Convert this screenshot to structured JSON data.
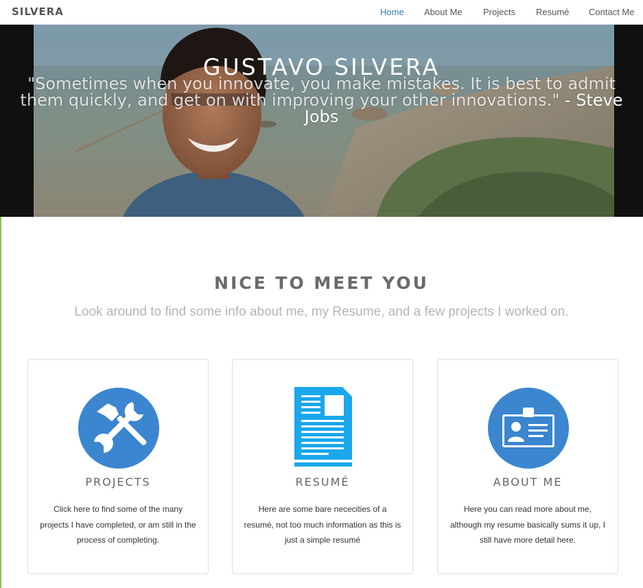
{
  "nav": {
    "brand": "SILVERA",
    "items": [
      {
        "label": "Home",
        "active": true
      },
      {
        "label": "About Me"
      },
      {
        "label": "Projects"
      },
      {
        "label": "Resumé"
      },
      {
        "label": "Contact Me"
      }
    ]
  },
  "hero": {
    "title": "GUSTAVO SILVERA",
    "quote": "\"Sometimes when you innovate, you make mistakes. It is best to admit them quickly, and get on with improving your other innovations.\"",
    "author": "- Steve Jobs"
  },
  "welcome": {
    "title": "NICE TO MEET YOU",
    "subtitle": "Look around to find some info about me, my Resume, and a few projects I worked on."
  },
  "cards": [
    {
      "icon": "tools-icon",
      "title": "PROJECTS",
      "text": "Click here to find some of the many projects I have completed, or am still in the process of completing."
    },
    {
      "icon": "document-icon",
      "title": "RESUMÉ",
      "text": "Here are some bare nececities of a resumé, not too much information as this is just a simple resumé"
    },
    {
      "icon": "id-badge-icon",
      "title": "ABOUT ME",
      "text": "Here you can read more about me, although my resume basically sums it up, I still have more detail here."
    }
  ],
  "colors": {
    "accent_link": "#337ab7",
    "icon_blue": "#3b86cf",
    "document_blue": "#1aa7ec"
  }
}
